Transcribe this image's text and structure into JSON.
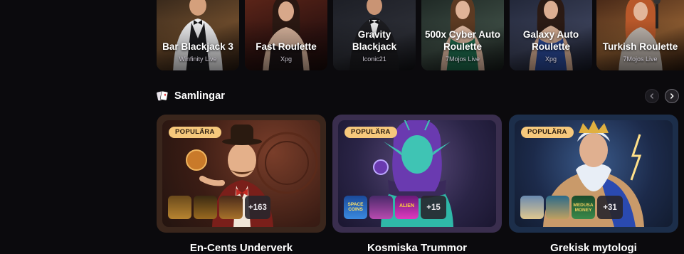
{
  "live_games": [
    {
      "title": "Bar Blackjack 3",
      "provider": "Winfinity Live"
    },
    {
      "title": "Fast Roulette",
      "provider": "Xpg"
    },
    {
      "title": "Gravity Blackjack",
      "provider": "Iconic21"
    },
    {
      "title": "500x Cyber Auto Roulette",
      "provider": "7Mojos Live"
    },
    {
      "title": "Galaxy Auto Roulette",
      "provider": "Xpg"
    },
    {
      "title": "Turkish Roulette",
      "provider": "7Mojos Live"
    }
  ],
  "collections_section": {
    "title": "Samlingar",
    "icons": {
      "section": "cards-icon",
      "prev": "chevron-left-icon",
      "next": "chevron-right-icon"
    }
  },
  "collections": [
    {
      "badge": "POPULÄRA",
      "more": "+163",
      "name": "En-Cents Underverk"
    },
    {
      "badge": "POPULÄRA",
      "more": "+15",
      "name": "Kosmiska Trummor"
    },
    {
      "badge": "POPULÄRA",
      "more": "+31",
      "name": "Grekisk mytologi"
    }
  ],
  "thumb_labels": {
    "space_coins": "SPACE COINS",
    "alien": "ALIEN",
    "medusa": "MEDUSA MONEY"
  },
  "colors": {
    "badge": "#f6c87c",
    "background": "#0b0a0d"
  }
}
